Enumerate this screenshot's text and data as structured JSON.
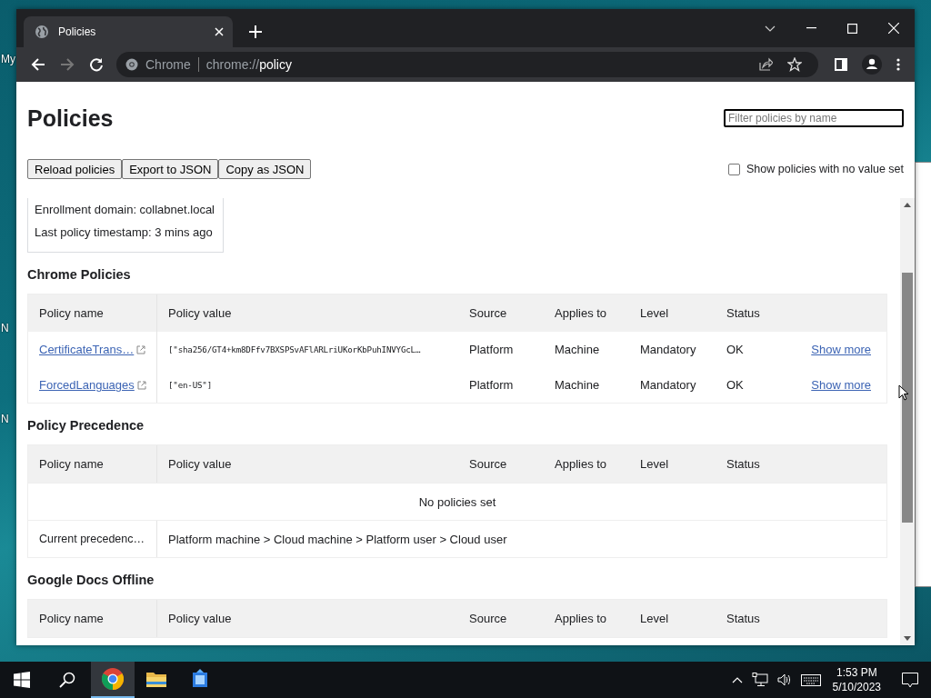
{
  "desktop": {
    "labels": [
      "My",
      "N",
      "N"
    ]
  },
  "browser": {
    "tabs": [
      {
        "title": "Policies",
        "selected": true
      }
    ],
    "omnibox": {
      "chip": "Chrome",
      "url_host": "chrome://",
      "url_path": "policy"
    }
  },
  "page": {
    "title": "Policies",
    "filter": {
      "placeholder": "Filter policies by name"
    },
    "buttons": [
      "Reload policies",
      "Export to JSON",
      "Copy as JSON"
    ],
    "show_unset": {
      "label": "Show policies with no value set",
      "checked": false
    },
    "status_box": [
      "Enrollment domain: collabnet.local",
      "Last policy timestamp: 3 mins ago"
    ],
    "sections": [
      {
        "kind": "policies",
        "title": "Chrome Policies",
        "columns": [
          "Policy name",
          "Policy value",
          "Source",
          "Applies to",
          "Level",
          "Status"
        ],
        "rows": [
          {
            "name": "CertificateTrans…",
            "value": "[\"sha256/GT4+km8DFfv7BXSPSvAFlARLriUKorKbPuhINVYGcL…",
            "source": "Platform",
            "applies_to": "Machine",
            "level": "Mandatory",
            "status": "OK",
            "action": "Show more"
          },
          {
            "name": "ForcedLanguages",
            "value": "[\"en-US\"]",
            "source": "Platform",
            "applies_to": "Machine",
            "level": "Mandatory",
            "status": "OK",
            "action": "Show more"
          }
        ]
      },
      {
        "kind": "precedence",
        "title": "Policy Precedence",
        "columns": [
          "Policy name",
          "Policy value",
          "Source",
          "Applies to",
          "Level",
          "Status"
        ],
        "message": "No policies set",
        "precedence_label": "Current precedenc…",
        "precedence_value": "Platform machine > Cloud machine > Platform user > Cloud user"
      },
      {
        "kind": "policies",
        "title": "Google Docs Offline",
        "columns": [
          "Policy name",
          "Policy value",
          "Source",
          "Applies to",
          "Level",
          "Status"
        ]
      }
    ]
  },
  "taskbar": {
    "apps": [
      {
        "kind": "chrome",
        "selected": true
      },
      {
        "kind": "folder",
        "selected": false
      },
      {
        "kind": "tool",
        "selected": false
      }
    ],
    "time": "1:53 PM",
    "date": "5/10/2023"
  }
}
